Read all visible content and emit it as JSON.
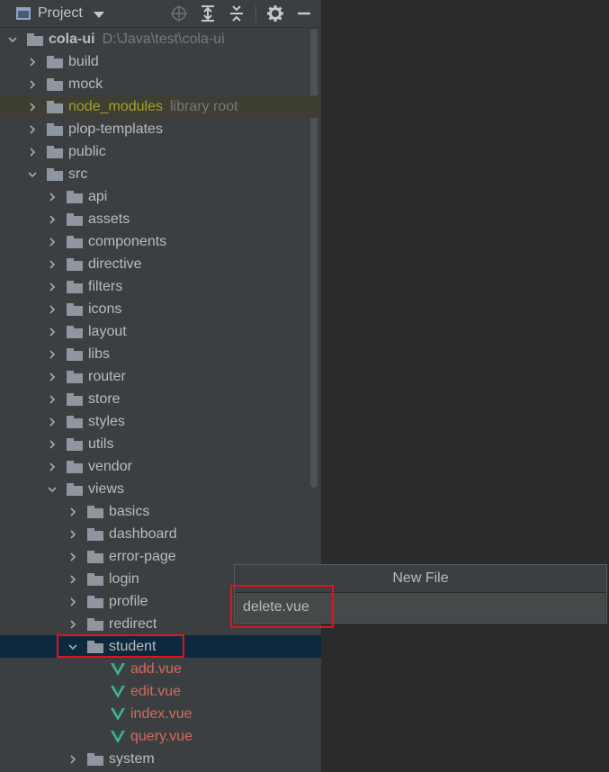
{
  "toolbar": {
    "title": "Project",
    "icons": [
      "locate-icon",
      "expand-all-icon",
      "collapse-all-icon",
      "gear-icon",
      "minimize-icon"
    ]
  },
  "tree": {
    "root_name": "cola-ui",
    "root_path": "D:\\Java\\test\\cola-ui",
    "library_root_hint": "library root",
    "items": [
      {
        "label": "build"
      },
      {
        "label": "mock"
      },
      {
        "label": "node_modules"
      },
      {
        "label": "plop-templates"
      },
      {
        "label": "public"
      },
      {
        "label": "src"
      },
      {
        "label": "api"
      },
      {
        "label": "assets"
      },
      {
        "label": "components"
      },
      {
        "label": "directive"
      },
      {
        "label": "filters"
      },
      {
        "label": "icons"
      },
      {
        "label": "layout"
      },
      {
        "label": "libs"
      },
      {
        "label": "router"
      },
      {
        "label": "store"
      },
      {
        "label": "styles"
      },
      {
        "label": "utils"
      },
      {
        "label": "vendor"
      },
      {
        "label": "views"
      },
      {
        "label": "basics"
      },
      {
        "label": "dashboard"
      },
      {
        "label": "error-page"
      },
      {
        "label": "login"
      },
      {
        "label": "profile"
      },
      {
        "label": "redirect"
      },
      {
        "label": "student"
      },
      {
        "label": "add.vue"
      },
      {
        "label": "edit.vue"
      },
      {
        "label": "index.vue"
      },
      {
        "label": "query.vue"
      },
      {
        "label": "system"
      }
    ]
  },
  "dialog": {
    "title": "New File",
    "input_value": "delete.vue"
  },
  "colors": {
    "panel_bg": "#3c3f41",
    "selection_bg": "#0d293e",
    "library_bg": "#3f3e33",
    "vue_file_text": "#d36b5d",
    "vue_logo": "#41b883",
    "highlight_box": "#e0141a"
  }
}
